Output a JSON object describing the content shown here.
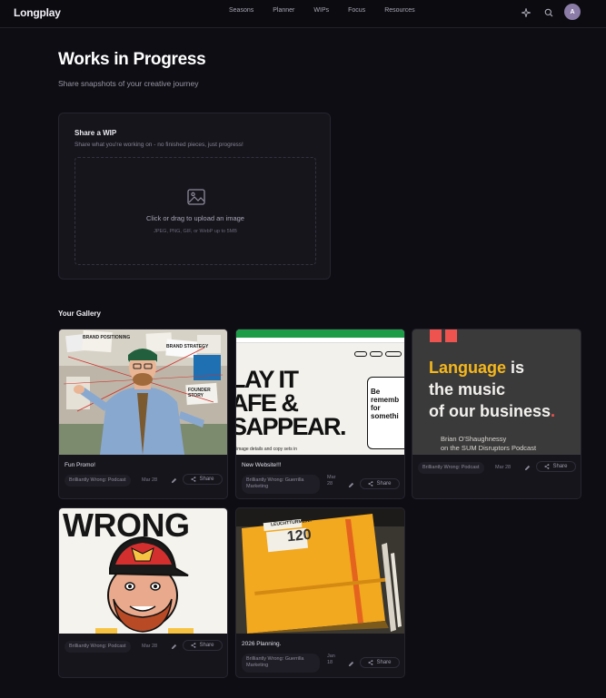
{
  "app": {
    "logo": "Longplay"
  },
  "nav": {
    "links": [
      "Seasons",
      "Planner",
      "WIPs",
      "Focus",
      "Resources"
    ],
    "avatar_initial": "A"
  },
  "page": {
    "title": "Works in Progress",
    "subtitle": "Share snapshots of your creative journey"
  },
  "upload": {
    "title": "Share a WIP",
    "description": "Share what you're working on - no finished pieces, just progress!",
    "label": "Click or drag to upload an image",
    "hint": "JPEG, PNG, GIF, or WebP up to 5MB"
  },
  "gallery": {
    "title": "Your Gallery",
    "share_label": "Share",
    "items": [
      {
        "title": "Fun Promo!",
        "tag": "Brilliantly Wrong: Podcast",
        "date": "Mar 28",
        "image_text": [
          "BRAND POSITIONING",
          "BRAND STRATEGY",
          "FOUNDER STORY"
        ]
      },
      {
        "title": "New Website!!!",
        "tag": "Brilliantly Wrong: Guerrilla Marketing",
        "date": "Mar 28",
        "image_text": [
          "LAY IT",
          "AFE &",
          "SAPPEAR.",
          "Be rememb for somethi",
          "image details and copy sets in"
        ]
      },
      {
        "title": "",
        "tag": "Brilliantly Wrong: Podcast",
        "date": "Mar 28",
        "image_text": [
          "Language",
          "is",
          "the music",
          "of our business",
          ".",
          "Brian O'Shaughnessy",
          "on the SUM Disruptors Podcast"
        ]
      },
      {
        "title": "",
        "tag": "Brilliantly Wrong: Podcast",
        "date": "Mar 28",
        "image_text": [
          "WRONG"
        ]
      },
      {
        "title": "2026 Planning.",
        "tag": "Brilliantly Wrong: Guerrilla Marketing",
        "date": "Jan 18",
        "image_text": [
          "LEUCHTTURM1917",
          "120"
        ]
      }
    ]
  },
  "colors": {
    "background": "#0e0d13",
    "card": "#16151c",
    "accent_yellow": "#f5b81c",
    "accent_red": "#ef5350"
  }
}
